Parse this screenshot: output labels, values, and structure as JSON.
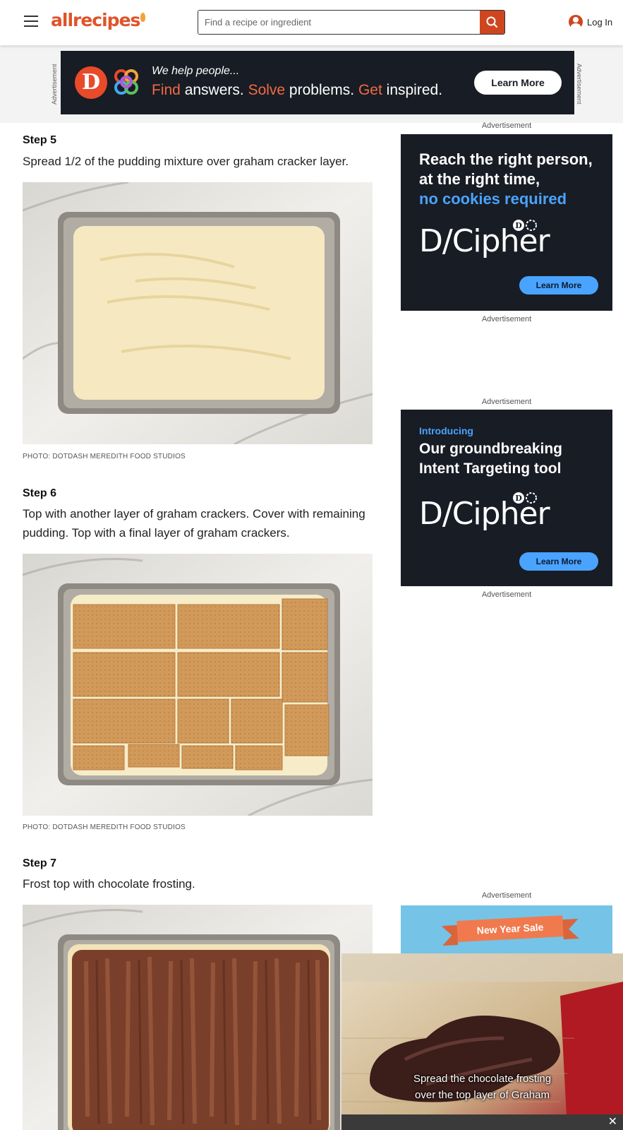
{
  "header": {
    "logo_text": "allrecipes",
    "search_placeholder": "Find a recipe or ingredient",
    "login_label": "Log In"
  },
  "top_ad": {
    "side_label": "Advertisement",
    "help_text": "We help people...",
    "tagline": {
      "find": "Find",
      "answers": " answers. ",
      "solve": "Solve",
      "problems": " problems. ",
      "get": "Get",
      "inspired": " inspired."
    },
    "button": "Learn More"
  },
  "steps": [
    {
      "title": "Step 5",
      "text": "Spread 1/2 of the pudding mixture over graham cracker layer.",
      "credit": "PHOTO: DOTDASH MEREDITH FOOD STUDIOS"
    },
    {
      "title": "Step 6",
      "text": "Top with another layer of graham crackers. Cover with remaining pudding. Top with a final layer of graham crackers.",
      "credit": "PHOTO: DOTDASH MEREDITH FOOD STUDIOS"
    },
    {
      "title": "Step 7",
      "text": "Frost top with chocolate frosting."
    }
  ],
  "sidebar": {
    "ad_label": "Advertisement",
    "ad1": {
      "line1": "Reach the right person,",
      "line2": "at the right time,",
      "line3": "no cookies required",
      "brand": "D/Cipher",
      "button": "Learn More"
    },
    "ad2": {
      "intro": "Introducing",
      "line1": "Our groundbreaking",
      "line2": "Intent Targeting tool",
      "brand": "D/Cipher",
      "button": "Learn More"
    },
    "ad3": {
      "ribbon": "New Year Sale"
    }
  },
  "video": {
    "caption_line1": "Spread the chocolate frosting",
    "caption_line2": "over the top layer of Graham",
    "close": "✕"
  },
  "colors": {
    "brand": "#ce4620",
    "ad_dark": "#181c24",
    "ad_blue": "#4aa3ff"
  }
}
